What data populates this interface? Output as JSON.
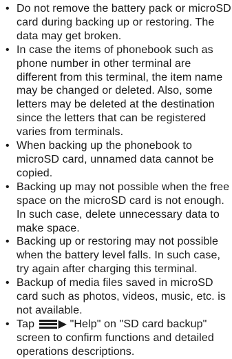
{
  "bullet": "•",
  "notes": [
    {
      "text": "Do not remove the battery pack or microSD card during backing up or restoring. The data may get broken."
    },
    {
      "text": "In case the items of phonebook such as phone number in other terminal are different from this terminal, the item name may be changed or deleted. Also, some letters may be deleted at the destination since the letters that can be registered varies from terminals."
    },
    {
      "text": "When backing up the phonebook to microSD card, unnamed data cannot be copied."
    },
    {
      "text": "Backing up may not possible when the free space on the microSD card is not enough. In such case, delete unnecessary data to make space."
    },
    {
      "text": "Backing up or restoring may not possible when the battery level falls. In such case, try again after charging this terminal."
    },
    {
      "text": "Backup of media files saved in microSD card such as photos, videos, music, etc. is not available."
    }
  ],
  "last_note": {
    "prefix": "Tap",
    "icon": "menu-icon",
    "arrow": "▶",
    "text": "\"Help\" on \"SD card backup\" screen to confirm functions and detailed operations descriptions."
  }
}
